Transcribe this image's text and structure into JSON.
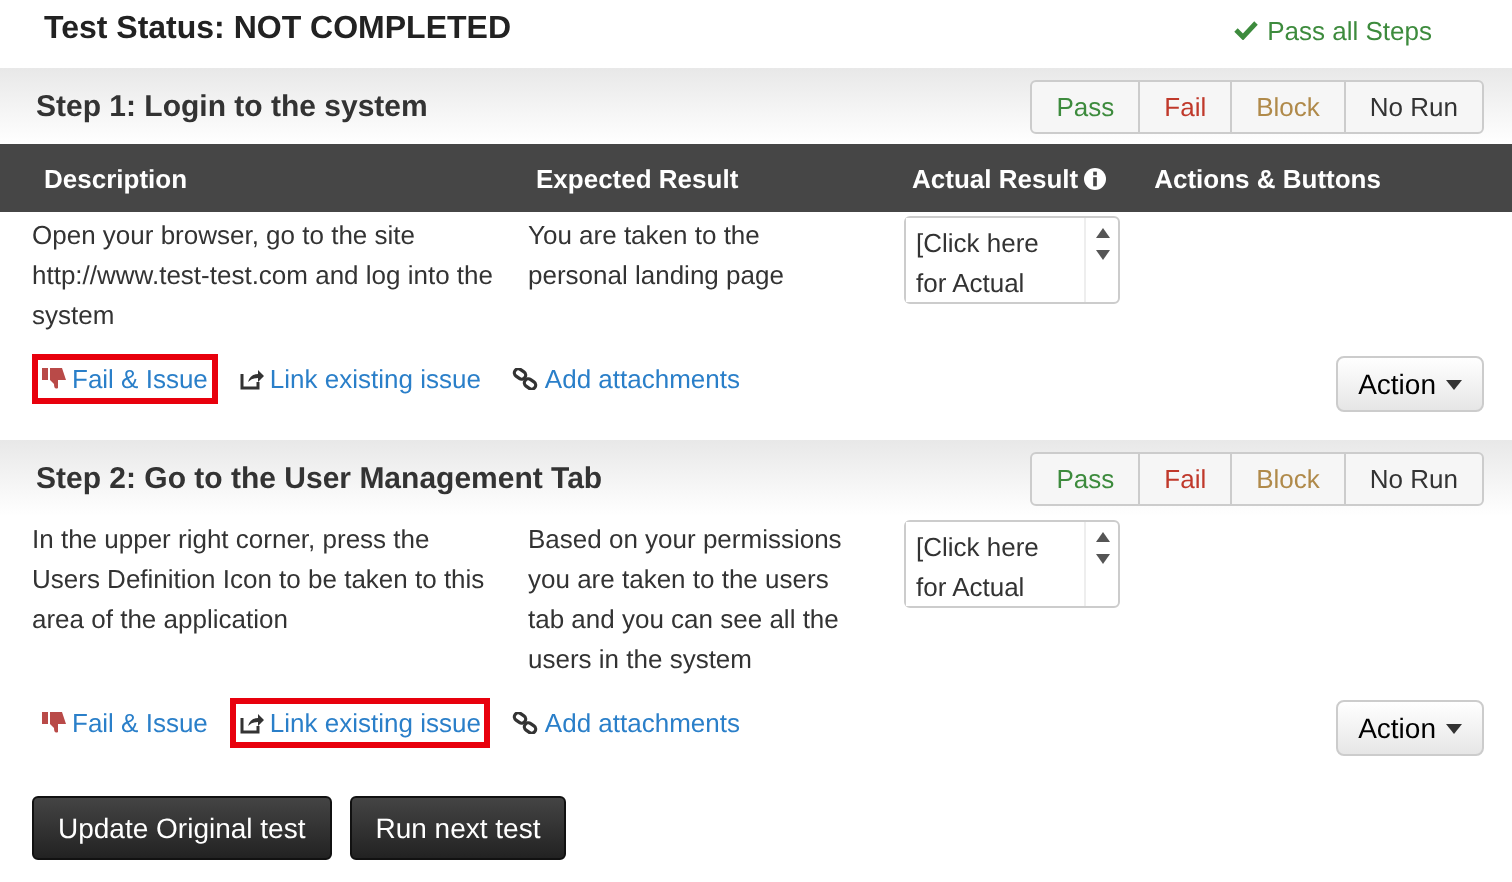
{
  "status": {
    "label": "Test Status: NOT COMPLETED",
    "pass_all": "Pass all Steps"
  },
  "columns": [
    "Description",
    "Expected Result",
    "Actual Result",
    "Actions & Buttons"
  ],
  "steps": [
    {
      "title": "Step 1: Login to the system",
      "results": [
        {
          "label": "Pass",
          "kind": "pass",
          "selected": false
        },
        {
          "label": "Fail",
          "kind": "fail",
          "selected": false
        },
        {
          "label": "Block",
          "kind": "block",
          "selected": false
        },
        {
          "label": "No Run",
          "kind": "norun",
          "selected": false
        }
      ],
      "description": "Open your browser, go to the site http://www.test-test.com and log into the system",
      "expected": "You are taken to the personal landing page",
      "actual_placeholder": "[Click here for Actual",
      "links": [
        {
          "label": "Fail & Issue",
          "kind": "fail",
          "highlighted": true
        },
        {
          "label": "Link existing issue",
          "kind": "link",
          "highlighted": false
        },
        {
          "label": "Add attachments",
          "kind": "attach",
          "highlighted": false
        }
      ],
      "action": "Action"
    },
    {
      "title": "Step 2: Go to the User Management Tab",
      "results": [
        {
          "label": "Pass",
          "kind": "pass",
          "selected": false
        },
        {
          "label": "Fail",
          "kind": "fail",
          "selected": false
        },
        {
          "label": "Block",
          "kind": "block",
          "selected": false
        },
        {
          "label": "No Run",
          "kind": "norun",
          "selected": false
        }
      ],
      "description": "In the upper right corner, press the Users Definition Icon to be taken to this area of the application",
      "expected": "Based on your permissions you are taken to the users tab and you can see all the users in the system",
      "actual_placeholder": "[Click here for Actual",
      "links": [
        {
          "label": "Fail & Issue",
          "kind": "fail",
          "highlighted": false
        },
        {
          "label": "Link existing issue",
          "kind": "link",
          "highlighted": true
        },
        {
          "label": "Add attachments",
          "kind": "attach",
          "highlighted": false
        }
      ],
      "action": "Action"
    }
  ],
  "buttons": [
    "Update Original test",
    "Run next test"
  ]
}
